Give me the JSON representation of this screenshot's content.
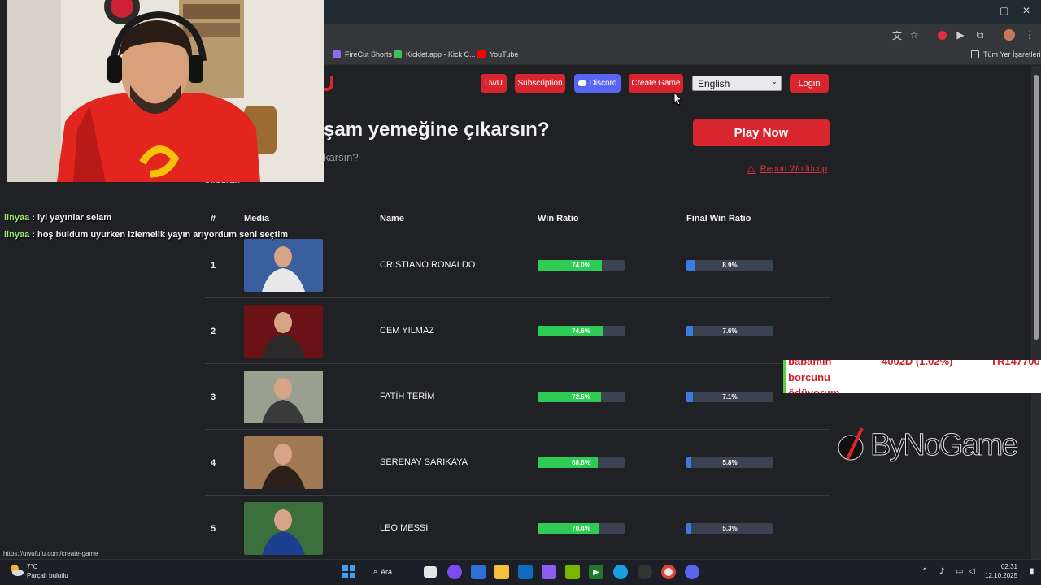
{
  "browser": {
    "window_controls": {
      "minimize": "—",
      "maximize": "▢",
      "close": "✕"
    },
    "bookmarks": [
      {
        "label": "FireCut Shorts",
        "color": "#8e6cf0"
      },
      {
        "label": "Kicklet.app - Kick C...",
        "color": "#3fbf5a"
      },
      {
        "label": "YouTube",
        "color": "#ff0000"
      }
    ],
    "all_bookmarks": "Tüm Yer İşaretleri"
  },
  "nav": {
    "uwu": "UwU",
    "subscription": "Subscription",
    "discord": "Discord",
    "create_game": "Create Game",
    "language": "English",
    "login": "Login"
  },
  "game": {
    "title": "şam yemeğine çıkarsın?",
    "subtitle": "karsın?",
    "creator": "st.burak",
    "play_now": "Play Now",
    "report": "Report Worldcup"
  },
  "table": {
    "headers": {
      "rank": "#",
      "media": "Media",
      "name": "Name",
      "win_ratio": "Win Ratio",
      "final_win_ratio": "Final Win Ratio"
    },
    "rows": [
      {
        "rank": "1",
        "name": "CRISTIANO RONALDO",
        "win_ratio": 74.0,
        "win_label": "74.0%",
        "final_ratio": 8.9,
        "final_label": "8.9%"
      },
      {
        "rank": "2",
        "name": "CEM YILMAZ",
        "win_ratio": 74.6,
        "win_label": "74.6%",
        "final_ratio": 7.6,
        "final_label": "7.6%"
      },
      {
        "rank": "3",
        "name": "FATİH TERİM",
        "win_ratio": 72.5,
        "win_label": "72.5%",
        "final_ratio": 7.1,
        "final_label": "7.1%"
      },
      {
        "rank": "4",
        "name": "SERENAY SARIKAYA",
        "win_ratio": 68.8,
        "win_label": "68.8%",
        "final_ratio": 5.8,
        "final_label": "5.8%"
      },
      {
        "rank": "5",
        "name": "LEO MESSI",
        "win_ratio": 70.4,
        "win_label": "70.4%",
        "final_ratio": 5.3,
        "final_label": "5.3%"
      }
    ],
    "colors": {
      "win": "#2ecc55",
      "final": "#3b7dde",
      "track": "#3b4252"
    }
  },
  "overlay": {
    "chat": [
      {
        "user": "linyaa",
        "sep": " : ",
        "message": "iyi yayınlar selam"
      },
      {
        "user": "linyaa",
        "sep": " : ",
        "message": "hoş buldum uyurken izlemelik yayın arıyordum seni seçtim"
      }
    ],
    "donation": {
      "line1": "babamın",
      "line2": "borcunu",
      "line3": "ödüyorum",
      "amount": "4002D (1.02%)",
      "iban": "TR147700"
    },
    "sponsor": "ByNoGame"
  },
  "status_url": "https://uwufufu.com/create-game",
  "taskbar": {
    "temp": "7°C",
    "weather": "Parçalı bulutlu",
    "search": "Ara",
    "time": "02:31",
    "date": "12.10.2025"
  }
}
